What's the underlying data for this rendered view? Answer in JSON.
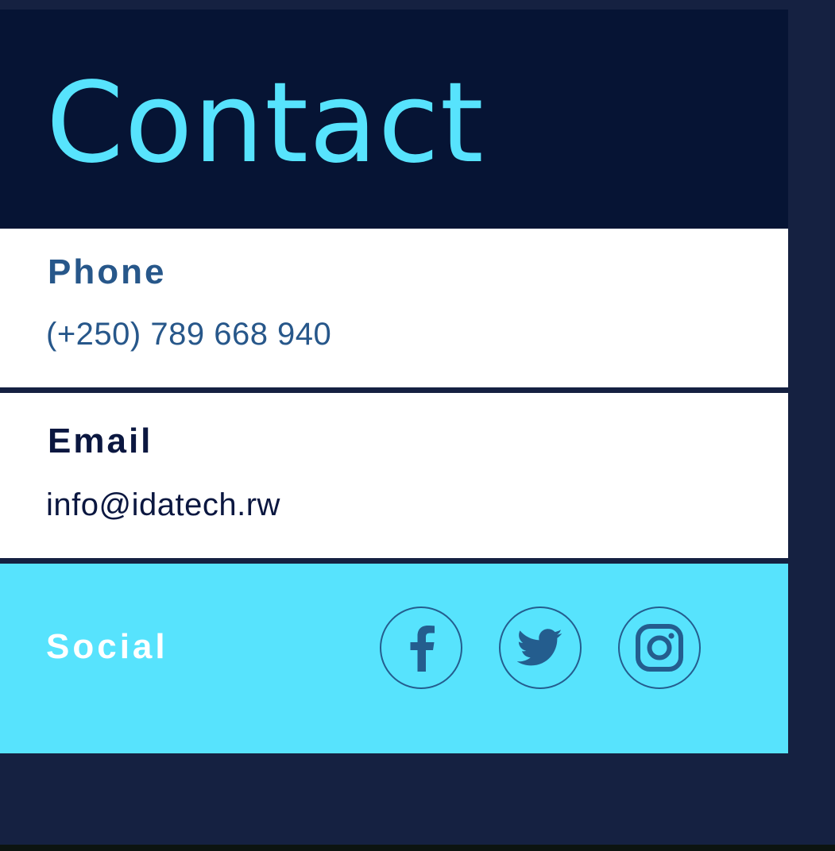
{
  "header": {
    "title": "Contact"
  },
  "phone": {
    "label": "Phone",
    "value": "(+250) 789 668 940"
  },
  "email": {
    "label": "Email",
    "value": "info@idatech.rw"
  },
  "social": {
    "label": "Social",
    "icons": [
      "facebook-icon",
      "twitter-icon",
      "instagram-icon"
    ]
  },
  "colors": {
    "page_background": "#152141",
    "header_background": "#061434",
    "accent_cyan": "#57e3fd",
    "phone_text": "#27578a",
    "email_text": "#0b1740",
    "icon_color": "#245d8e"
  }
}
